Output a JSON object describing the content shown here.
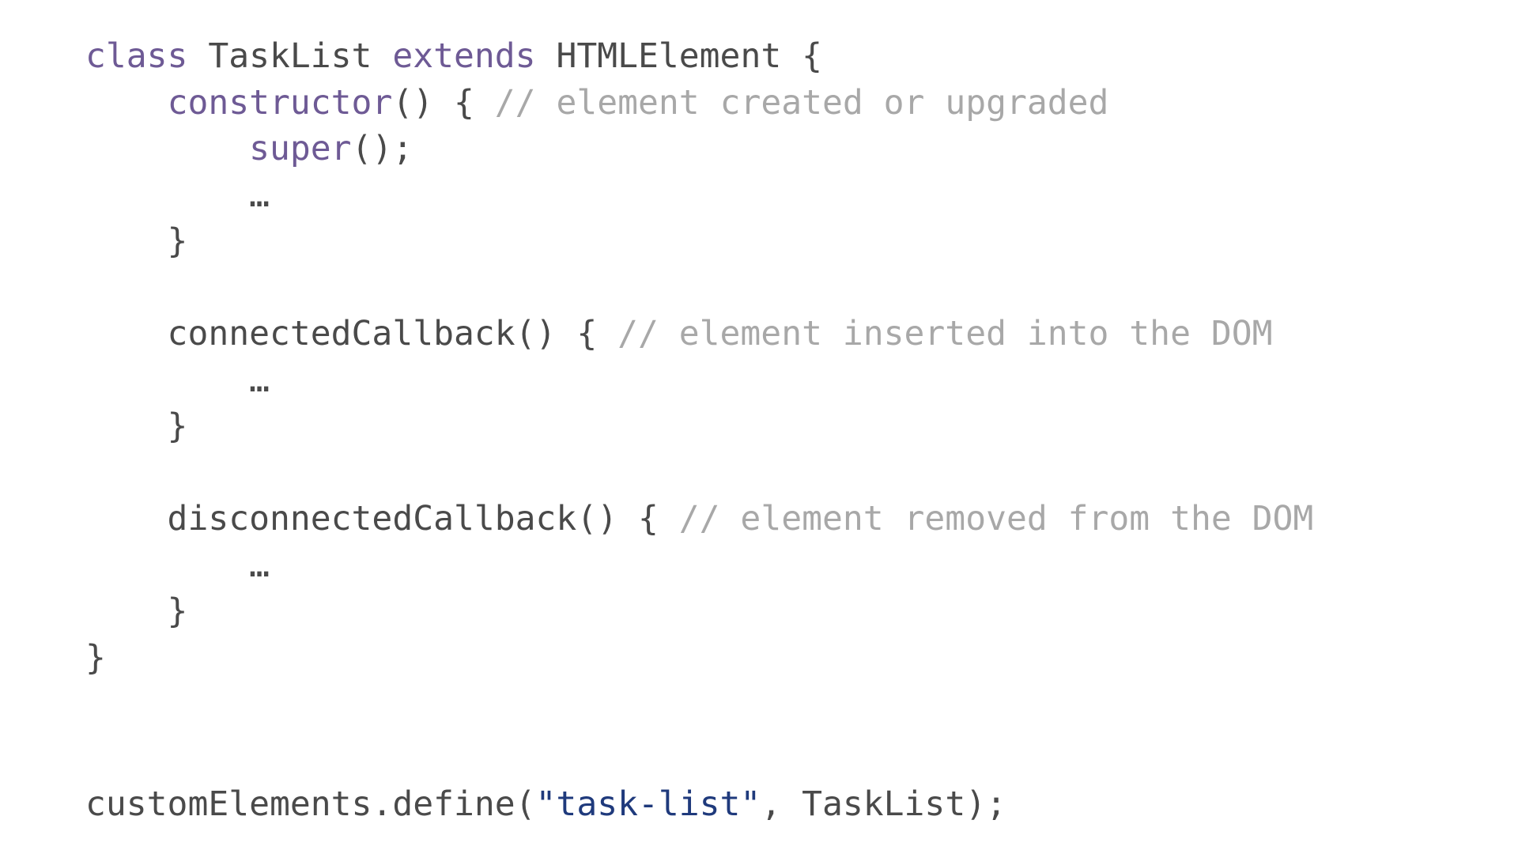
{
  "editor": {
    "lines": [
      [
        {
          "t": "kw",
          "v": "class"
        },
        {
          "t": "pl",
          "v": " TaskList "
        },
        {
          "t": "kw",
          "v": "extends"
        },
        {
          "t": "pl",
          "v": " HTMLElement {"
        }
      ],
      [
        {
          "t": "pl",
          "v": "    "
        },
        {
          "t": "kw",
          "v": "constructor"
        },
        {
          "t": "pl",
          "v": "() { "
        },
        {
          "t": "cm",
          "v": "// element created or upgraded"
        }
      ],
      [
        {
          "t": "pl",
          "v": "        "
        },
        {
          "t": "kw",
          "v": "super"
        },
        {
          "t": "pl",
          "v": "();"
        }
      ],
      [
        {
          "t": "pl",
          "v": "        …"
        }
      ],
      [
        {
          "t": "pl",
          "v": "    }"
        }
      ],
      [
        {
          "t": "pl",
          "v": ""
        }
      ],
      [
        {
          "t": "pl",
          "v": "    connectedCallback() { "
        },
        {
          "t": "cm",
          "v": "// element inserted into the DOM"
        }
      ],
      [
        {
          "t": "pl",
          "v": "        …"
        }
      ],
      [
        {
          "t": "pl",
          "v": "    }"
        }
      ],
      [
        {
          "t": "pl",
          "v": ""
        }
      ],
      [
        {
          "t": "pl",
          "v": "    disconnectedCallback() { "
        },
        {
          "t": "cm",
          "v": "// element removed from the DOM"
        }
      ],
      [
        {
          "t": "pl",
          "v": "        …"
        }
      ],
      [
        {
          "t": "pl",
          "v": "    }"
        }
      ],
      [
        {
          "t": "pl",
          "v": "}"
        }
      ]
    ],
    "final_line": [
      {
        "t": "pl",
        "v": "customElements.define("
      },
      {
        "t": "str",
        "v": "\"task-list\""
      },
      {
        "t": "pl",
        "v": ", TaskList);"
      }
    ]
  },
  "colors": {
    "keyword": "#6e5a95",
    "plain": "#4a4a4a",
    "comment": "#a8a8a8",
    "string": "#1f3a7c",
    "background": "#ffffff"
  }
}
